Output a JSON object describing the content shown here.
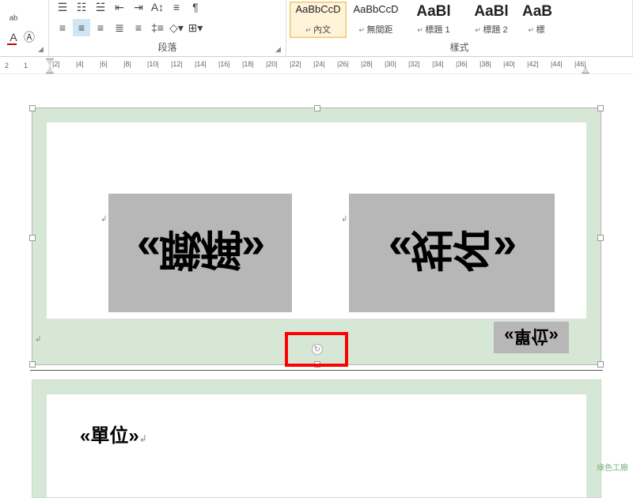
{
  "ribbon": {
    "paragraph_label": "段落",
    "styles_label": "樣式",
    "styles": [
      {
        "preview": "AaBbCcD",
        "name": "內文",
        "cls": ""
      },
      {
        "preview": "AaBbCcD",
        "name": "無間距",
        "cls": ""
      },
      {
        "preview": "AaBl",
        "name": "標題 1",
        "cls": "header"
      },
      {
        "preview": "AaBl",
        "name": "標題 2",
        "cls": "header"
      },
      {
        "preview": "AaB",
        "name": "標",
        "cls": "header"
      }
    ]
  },
  "ruler": {
    "marks": [
      "2",
      "1",
      "",
      "|2|",
      "|4|",
      "|6|",
      "|8|",
      "|10|",
      "|12|",
      "|14|",
      "|16|",
      "|18|",
      "|20|",
      "|22|",
      "|24|",
      "|26|",
      "|28|",
      "|30|",
      "|32|",
      "|34|",
      "|36|",
      "|38|",
      "|40|",
      "|42|",
      "|44|",
      "|46|"
    ]
  },
  "fields": {
    "box1_left": "«職稱»",
    "box1_right": "«姓名»",
    "box1_small": "«單位»",
    "box2_text": "«單位»"
  },
  "watermark": "綠色工廠"
}
